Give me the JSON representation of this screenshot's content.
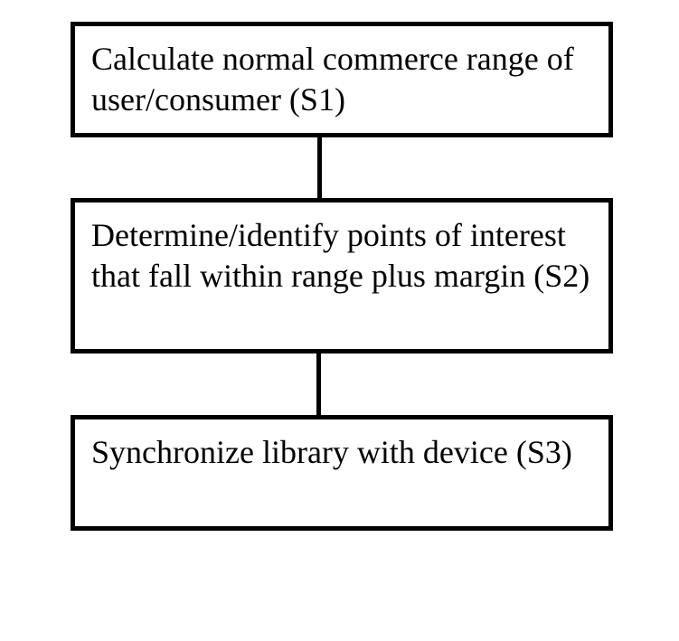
{
  "diagram": {
    "type": "flowchart",
    "orientation": "vertical",
    "steps": [
      {
        "id": "S1",
        "text": "Calculate normal commerce range of user/consumer (S1)"
      },
      {
        "id": "S2",
        "text": "Determine/identify points of interest that fall within range plus margin (S2)"
      },
      {
        "id": "S3",
        "text": "Synchronize library with device (S3)"
      }
    ],
    "edges": [
      {
        "from": "S1",
        "to": "S2"
      },
      {
        "from": "S2",
        "to": "S3"
      }
    ]
  }
}
